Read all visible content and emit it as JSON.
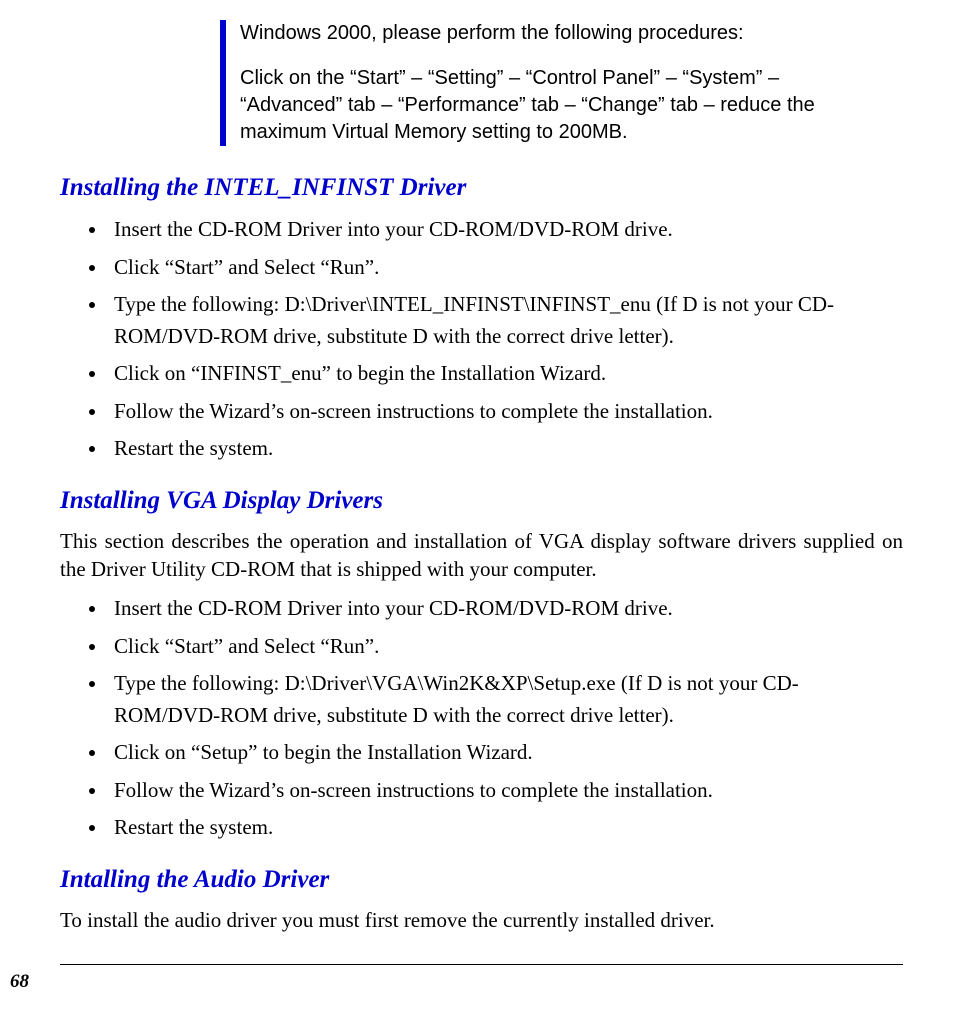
{
  "note": {
    "p1": "Windows 2000, please perform the following procedures:",
    "p2": "Click on the “Start” – “Setting” – “Control Panel” – “System” – “Advanced” tab – “Performance” tab – “Change” tab – reduce the maximum Virtual Memory setting to 200MB."
  },
  "section1": {
    "heading": "Installing the INTEL_INFINST Driver",
    "items": [
      "Insert the CD-ROM Driver into your CD-ROM/DVD-ROM drive.",
      "Click “Start” and Select “Run”.",
      "Type the following: D:\\Driver\\INTEL_INFINST\\INFINST_enu (If D is not your CD-ROM/DVD-ROM drive, substitute D with the correct drive letter).",
      "Click on “INFINST_enu” to begin the Installation Wizard.",
      "Follow the Wizard’s on-screen instructions to complete the installation.",
      "Restart the system."
    ]
  },
  "section2": {
    "heading": "Installing VGA Display Drivers",
    "intro": "This section describes the operation and installation of VGA display software drivers supplied on the Driver Utility CD-ROM that is shipped with your computer.",
    "items": [
      "Insert the CD-ROM Driver into your CD-ROM/DVD-ROM drive.",
      "Click “Start” and Select “Run”.",
      "Type the following: D:\\Driver\\VGA\\Win2K&XP\\Setup.exe (If D is not your CD-ROM/DVD-ROM drive, substitute D with the correct drive letter).",
      "Click on “Setup” to begin the Installation Wizard.",
      "Follow the Wizard’s on-screen instructions to complete the installation.",
      "Restart the system."
    ]
  },
  "section3": {
    "heading": "Intalling the Audio Driver",
    "intro": "To install the audio driver you must first remove the currently installed driver."
  },
  "page_number": "68"
}
